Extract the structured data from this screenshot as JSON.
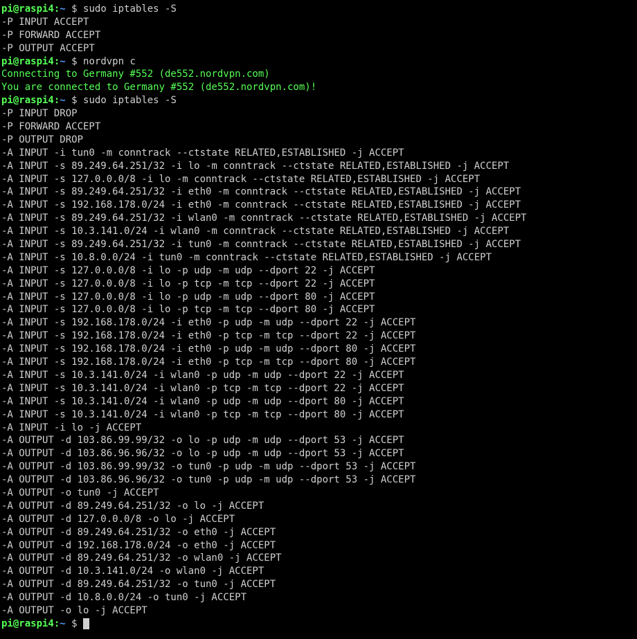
{
  "prompt": {
    "user": "pi@raspi4",
    "colon": ":",
    "path": "~",
    "dollar": " $ "
  },
  "session": [
    {
      "type": "prompt",
      "cmd": "sudo iptables -S"
    },
    {
      "type": "out",
      "text": "-P INPUT ACCEPT"
    },
    {
      "type": "out",
      "text": "-P FORWARD ACCEPT"
    },
    {
      "type": "out",
      "text": "-P OUTPUT ACCEPT"
    },
    {
      "type": "prompt",
      "cmd": "nordvpn c"
    },
    {
      "type": "green",
      "text": "Connecting to Germany #552 (de552.nordvpn.com)"
    },
    {
      "type": "green",
      "text": "You are connected to Germany #552 (de552.nordvpn.com)!"
    },
    {
      "type": "prompt",
      "cmd": "sudo iptables -S"
    },
    {
      "type": "out",
      "text": "-P INPUT DROP"
    },
    {
      "type": "out",
      "text": "-P FORWARD ACCEPT"
    },
    {
      "type": "out",
      "text": "-P OUTPUT DROP"
    },
    {
      "type": "out",
      "text": "-A INPUT -i tun0 -m conntrack --ctstate RELATED,ESTABLISHED -j ACCEPT"
    },
    {
      "type": "out",
      "text": "-A INPUT -s 89.249.64.251/32 -i lo -m conntrack --ctstate RELATED,ESTABLISHED -j ACCEPT"
    },
    {
      "type": "out",
      "text": "-A INPUT -s 127.0.0.0/8 -i lo -m conntrack --ctstate RELATED,ESTABLISHED -j ACCEPT"
    },
    {
      "type": "out",
      "text": "-A INPUT -s 89.249.64.251/32 -i eth0 -m conntrack --ctstate RELATED,ESTABLISHED -j ACCEPT"
    },
    {
      "type": "out",
      "text": "-A INPUT -s 192.168.178.0/24 -i eth0 -m conntrack --ctstate RELATED,ESTABLISHED -j ACCEPT"
    },
    {
      "type": "out",
      "text": "-A INPUT -s 89.249.64.251/32 -i wlan0 -m conntrack --ctstate RELATED,ESTABLISHED -j ACCEPT"
    },
    {
      "type": "out",
      "text": "-A INPUT -s 10.3.141.0/24 -i wlan0 -m conntrack --ctstate RELATED,ESTABLISHED -j ACCEPT"
    },
    {
      "type": "out",
      "text": "-A INPUT -s 89.249.64.251/32 -i tun0 -m conntrack --ctstate RELATED,ESTABLISHED -j ACCEPT"
    },
    {
      "type": "out",
      "text": "-A INPUT -s 10.8.0.0/24 -i tun0 -m conntrack --ctstate RELATED,ESTABLISHED -j ACCEPT"
    },
    {
      "type": "out",
      "text": "-A INPUT -s 127.0.0.0/8 -i lo -p udp -m udp --dport 22 -j ACCEPT"
    },
    {
      "type": "out",
      "text": "-A INPUT -s 127.0.0.0/8 -i lo -p tcp -m tcp --dport 22 -j ACCEPT"
    },
    {
      "type": "out",
      "text": "-A INPUT -s 127.0.0.0/8 -i lo -p udp -m udp --dport 80 -j ACCEPT"
    },
    {
      "type": "out",
      "text": "-A INPUT -s 127.0.0.0/8 -i lo -p tcp -m tcp --dport 80 -j ACCEPT"
    },
    {
      "type": "out",
      "text": "-A INPUT -s 192.168.178.0/24 -i eth0 -p udp -m udp --dport 22 -j ACCEPT"
    },
    {
      "type": "out",
      "text": "-A INPUT -s 192.168.178.0/24 -i eth0 -p tcp -m tcp --dport 22 -j ACCEPT"
    },
    {
      "type": "out",
      "text": "-A INPUT -s 192.168.178.0/24 -i eth0 -p udp -m udp --dport 80 -j ACCEPT"
    },
    {
      "type": "out",
      "text": "-A INPUT -s 192.168.178.0/24 -i eth0 -p tcp -m tcp --dport 80 -j ACCEPT"
    },
    {
      "type": "out",
      "text": "-A INPUT -s 10.3.141.0/24 -i wlan0 -p udp -m udp --dport 22 -j ACCEPT"
    },
    {
      "type": "out",
      "text": "-A INPUT -s 10.3.141.0/24 -i wlan0 -p tcp -m tcp --dport 22 -j ACCEPT"
    },
    {
      "type": "out",
      "text": "-A INPUT -s 10.3.141.0/24 -i wlan0 -p udp -m udp --dport 80 -j ACCEPT"
    },
    {
      "type": "out",
      "text": "-A INPUT -s 10.3.141.0/24 -i wlan0 -p tcp -m tcp --dport 80 -j ACCEPT"
    },
    {
      "type": "out",
      "text": "-A INPUT -i lo -j ACCEPT"
    },
    {
      "type": "out",
      "text": "-A OUTPUT -d 103.86.99.99/32 -o lo -p udp -m udp --dport 53 -j ACCEPT"
    },
    {
      "type": "out",
      "text": "-A OUTPUT -d 103.86.96.96/32 -o lo -p udp -m udp --dport 53 -j ACCEPT"
    },
    {
      "type": "out",
      "text": "-A OUTPUT -d 103.86.99.99/32 -o tun0 -p udp -m udp --dport 53 -j ACCEPT"
    },
    {
      "type": "out",
      "text": "-A OUTPUT -d 103.86.96.96/32 -o tun0 -p udp -m udp --dport 53 -j ACCEPT"
    },
    {
      "type": "out",
      "text": "-A OUTPUT -o tun0 -j ACCEPT"
    },
    {
      "type": "out",
      "text": "-A OUTPUT -d 89.249.64.251/32 -o lo -j ACCEPT"
    },
    {
      "type": "out",
      "text": "-A OUTPUT -d 127.0.0.0/8 -o lo -j ACCEPT"
    },
    {
      "type": "out",
      "text": "-A OUTPUT -d 89.249.64.251/32 -o eth0 -j ACCEPT"
    },
    {
      "type": "out",
      "text": "-A OUTPUT -d 192.168.178.0/24 -o eth0 -j ACCEPT"
    },
    {
      "type": "out",
      "text": "-A OUTPUT -d 89.249.64.251/32 -o wlan0 -j ACCEPT"
    },
    {
      "type": "out",
      "text": "-A OUTPUT -d 10.3.141.0/24 -o wlan0 -j ACCEPT"
    },
    {
      "type": "out",
      "text": "-A OUTPUT -d 89.249.64.251/32 -o tun0 -j ACCEPT"
    },
    {
      "type": "out",
      "text": "-A OUTPUT -d 10.8.0.0/24 -o tun0 -j ACCEPT"
    },
    {
      "type": "out",
      "text": "-A OUTPUT -o lo -j ACCEPT"
    },
    {
      "type": "prompt",
      "cmd": "",
      "cursor": true
    }
  ]
}
